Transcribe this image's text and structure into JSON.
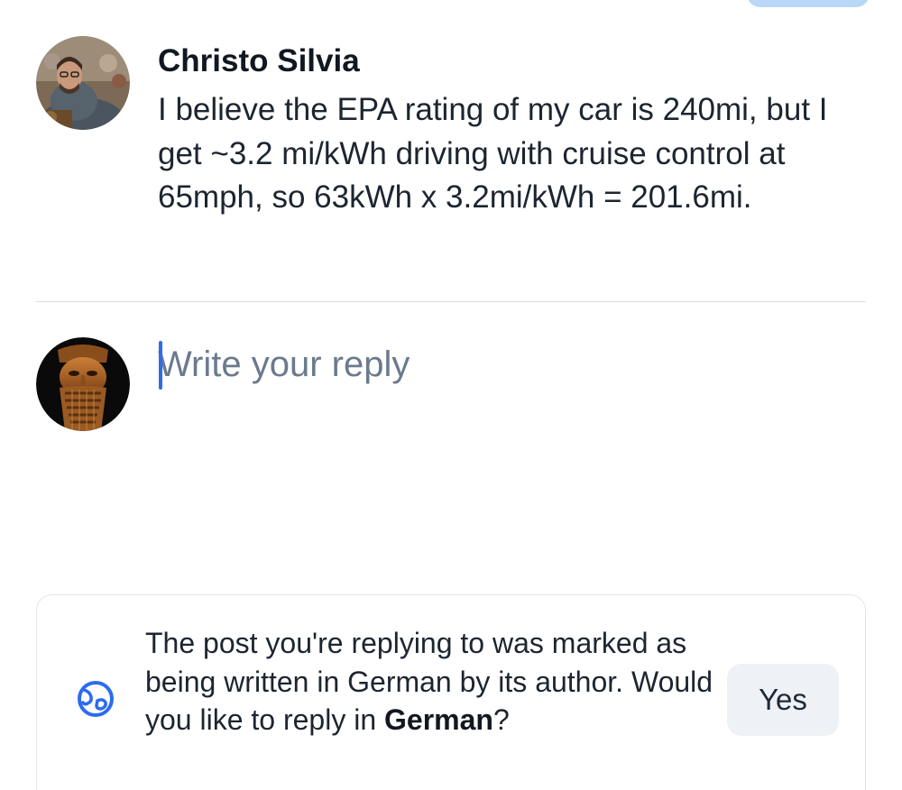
{
  "post": {
    "author": "Christo Silvia",
    "avatar": "user-avatar-photo",
    "text": "I believe the EPA rating of my car is 240mi, but I get ~3.2 mi/kWh driving with cruise control at 65mph, so 63kWh x 3.2mi/kWh = 201.6mi."
  },
  "reply": {
    "avatar": "current-user-avatar",
    "placeholder": "Write your reply",
    "value": ""
  },
  "language_prompt": {
    "icon": "globe-icon",
    "message_before": "The post you're replying to was marked as being written in German by its author. Would you like to reply in ",
    "language": "German",
    "message_after": "?",
    "yes_label": "Yes"
  },
  "colors": {
    "accent": "#2d6bf0",
    "text_primary": "#1c2530",
    "placeholder": "#6b7a8d",
    "divider": "#d9dee5",
    "button_bg": "#eef1f5"
  }
}
